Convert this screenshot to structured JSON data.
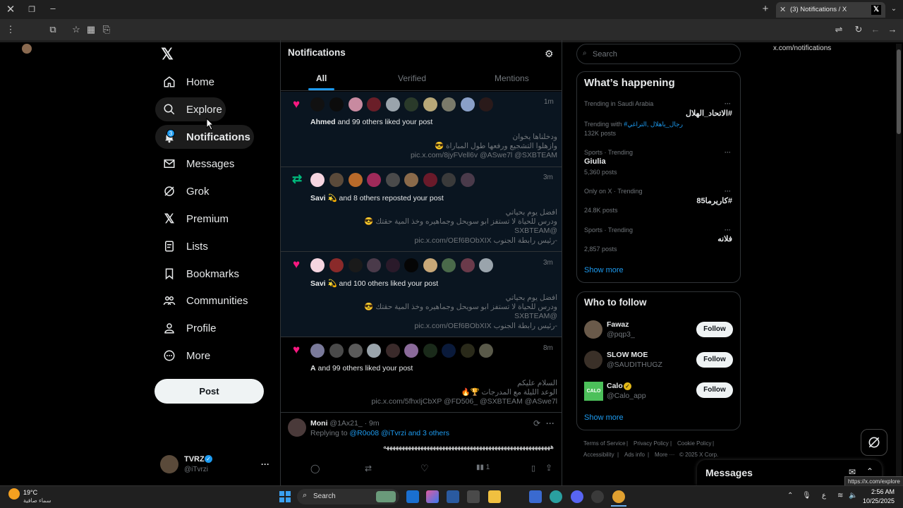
{
  "browser": {
    "tab_title": "(3) Notifications / X",
    "url": "x.com/notifications",
    "status_url": "https://x.com/explore"
  },
  "nav": {
    "items": [
      {
        "label": "Home"
      },
      {
        "label": "Explore"
      },
      {
        "label": "Notifications",
        "badge": "3"
      },
      {
        "label": "Messages"
      },
      {
        "label": "Grok"
      },
      {
        "label": "Premium"
      },
      {
        "label": "Lists"
      },
      {
        "label": "Bookmarks"
      },
      {
        "label": "Communities"
      },
      {
        "label": "Profile"
      },
      {
        "label": "More"
      }
    ],
    "post_label": "Post",
    "account": {
      "name": "TVRZ",
      "handle": "@iTvrzi"
    }
  },
  "notifications": {
    "title": "Notifications",
    "tabs": [
      "All",
      "Verified",
      "Mentions"
    ],
    "items": [
      {
        "text_bold": "Ahmed",
        "text_rest": " and 99 others liked your post",
        "time": "1m",
        "lines": [
          "ودخلناها يخوان",
          "وازهلوا التشجيع ورفعها طول المباراة 😎",
          "pic.x.com/8jyFVell6v @ASwe7l @SXBTEAM"
        ]
      },
      {
        "text_bold": "Savi 💫",
        "text_rest": " and 8 others reposted your post",
        "time": "3m",
        "lines": [
          "افضل يوم بحياتي",
          "ودرس للحياة لا تستفز ابو سويحل وجماهيره وخذ المية حقتك 😎",
          "@SXBTEAM",
          "-رئيس رابطة الجنوب pic.x.com/OEf6BObXIX"
        ]
      },
      {
        "text_bold": "Savi 💫",
        "text_rest": " and 100 others liked your post",
        "time": "3m",
        "lines": [
          "افضل يوم بحياتي",
          "ودرس للحياة لا تستفز ابو سويحل وجماهيره وخذ المية حقتك 😎",
          "@SXBTEAM",
          "-رئيس رابطة الجنوب pic.x.com/OEf6BObXIX"
        ]
      },
      {
        "text_bold": "A",
        "text_rest": " and 99 others liked your post",
        "time": "8m",
        "lines": [
          "السلام عليكم",
          "الوعد الليلة مع المدرجات 🏆🔥",
          "pic.x.com/5fhxIjCbXP @FD506_ @SXBTEAM @ASwe7l"
        ]
      }
    ],
    "reply": {
      "name": "Moni",
      "handle": "@1Ax21_",
      "time": "· 9m",
      "replying_prefix": "Replying to ",
      "replying_to": "@R0o08 @iTvrzi and 3 others",
      "body": "ههههههههههههههههههههههههههههههههههههههههههههههههههههههه",
      "views": "1"
    }
  },
  "right": {
    "search_placeholder": "Search",
    "whats_happening": {
      "title": "What’s happening",
      "trends": [
        {
          "meta": "Trending in Saudi Arabia",
          "name": "#الاتحاد_الهلال",
          "extra_label": "Trending with",
          "extra_link": "#رجال_ياهلال ,التراغي",
          "posts": "132K posts"
        },
        {
          "meta": "Sports · Trending",
          "name": "Giulia",
          "posts": "5,360 posts"
        },
        {
          "meta": "Only on X · Trending",
          "name": "#كاريرما85",
          "posts": "24.8K posts"
        },
        {
          "meta": "Sports · Trending",
          "name": "فلانه",
          "posts": "2,857 posts"
        }
      ],
      "show_more": "Show more"
    },
    "who_to_follow": {
      "title": "Who to follow",
      "users": [
        {
          "name": "Fawaz",
          "handle": "@pqp3_",
          "button": "Follow"
        },
        {
          "name": "SLOW MOE",
          "handle": "@SAUDITHUGZ",
          "button": "Follow"
        },
        {
          "name": "Calo",
          "handle": "@Calo_app",
          "button": "Follow",
          "avatar_text": "CALO"
        }
      ],
      "show_more": "Show more"
    },
    "footer": [
      "Terms of Service",
      "Privacy Policy",
      "Cookie Policy",
      "Accessibility",
      "Ads info",
      "More ···",
      "© 2025 X Corp."
    ],
    "messages_title": "Messages"
  },
  "taskbar": {
    "weather_temp": "19°C",
    "weather_desc": "سماء صافية",
    "search_label": "Search",
    "time": "2:56 AM",
    "date": "10/25/2025",
    "lang": "ع"
  },
  "colors": {
    "accent": "#1d9bf0",
    "like": "#f91880",
    "repost": "#00ba7c",
    "background": "#000000"
  }
}
